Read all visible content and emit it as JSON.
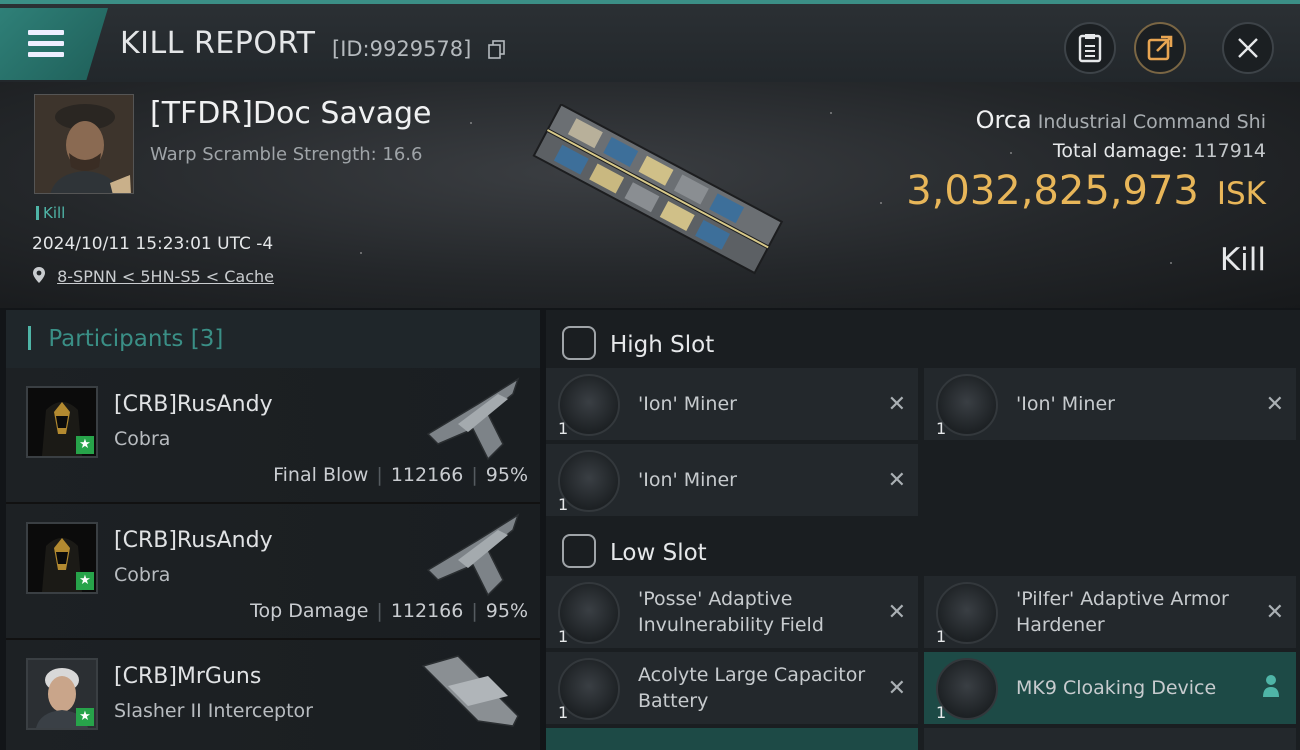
{
  "header": {
    "title": "KILL REPORT",
    "report_id": "[ID:9929578]"
  },
  "victim": {
    "name": "[TFDR]Doc Savage",
    "warp_scramble": "Warp Scramble Strength: 16.6",
    "tag": "Kill",
    "timestamp": "2024/10/11 15:23:01 UTC -4",
    "location": "8-SPNN < 5HN-S5 < Cache",
    "ship_name": "Orca",
    "ship_class": "Industrial Command Shi",
    "damage_label": "Total damage:",
    "damage_value": "117914",
    "isk_value": "3,032,825,973",
    "isk_unit": "ISK",
    "result": "Kill"
  },
  "participants": {
    "label": "Participants",
    "count": "[3]",
    "items": [
      {
        "name": "[CRB]RusAndy",
        "ship": "Cobra",
        "role": "Final Blow",
        "damage": "112166",
        "percent": "95%"
      },
      {
        "name": "[CRB]RusAndy",
        "ship": "Cobra",
        "role": "Top Damage",
        "damage": "112166",
        "percent": "95%"
      },
      {
        "name": "[CRB]MrGuns",
        "ship": "Slasher II Interceptor"
      }
    ]
  },
  "slots": {
    "high": {
      "label": "High Slot",
      "items": [
        {
          "name": "'Ion' Miner",
          "qty": "1"
        },
        {
          "name": "'Ion' Miner",
          "qty": "1"
        },
        {
          "name": "'Ion' Miner",
          "qty": "1"
        }
      ]
    },
    "low": {
      "label": "Low Slot",
      "items": [
        {
          "name": "'Posse' Adaptive Invulnerability Field",
          "qty": "1"
        },
        {
          "name": "'Pilfer' Adaptive Armor Hardener",
          "qty": "1"
        },
        {
          "name": "Acolyte Large Capacitor Battery",
          "qty": "1"
        },
        {
          "name": "MK9 Cloaking Device",
          "qty": "1"
        }
      ]
    }
  },
  "icons": {
    "close": "x-icon",
    "menu": "hamburger-icon",
    "report": "clipboard-icon",
    "share": "share-icon",
    "copy": "copy-icon",
    "location": "map-pin-icon"
  },
  "colors": {
    "accent": "#3b8f86",
    "isk": "#e8b659",
    "highlight": "#1d4a46"
  }
}
